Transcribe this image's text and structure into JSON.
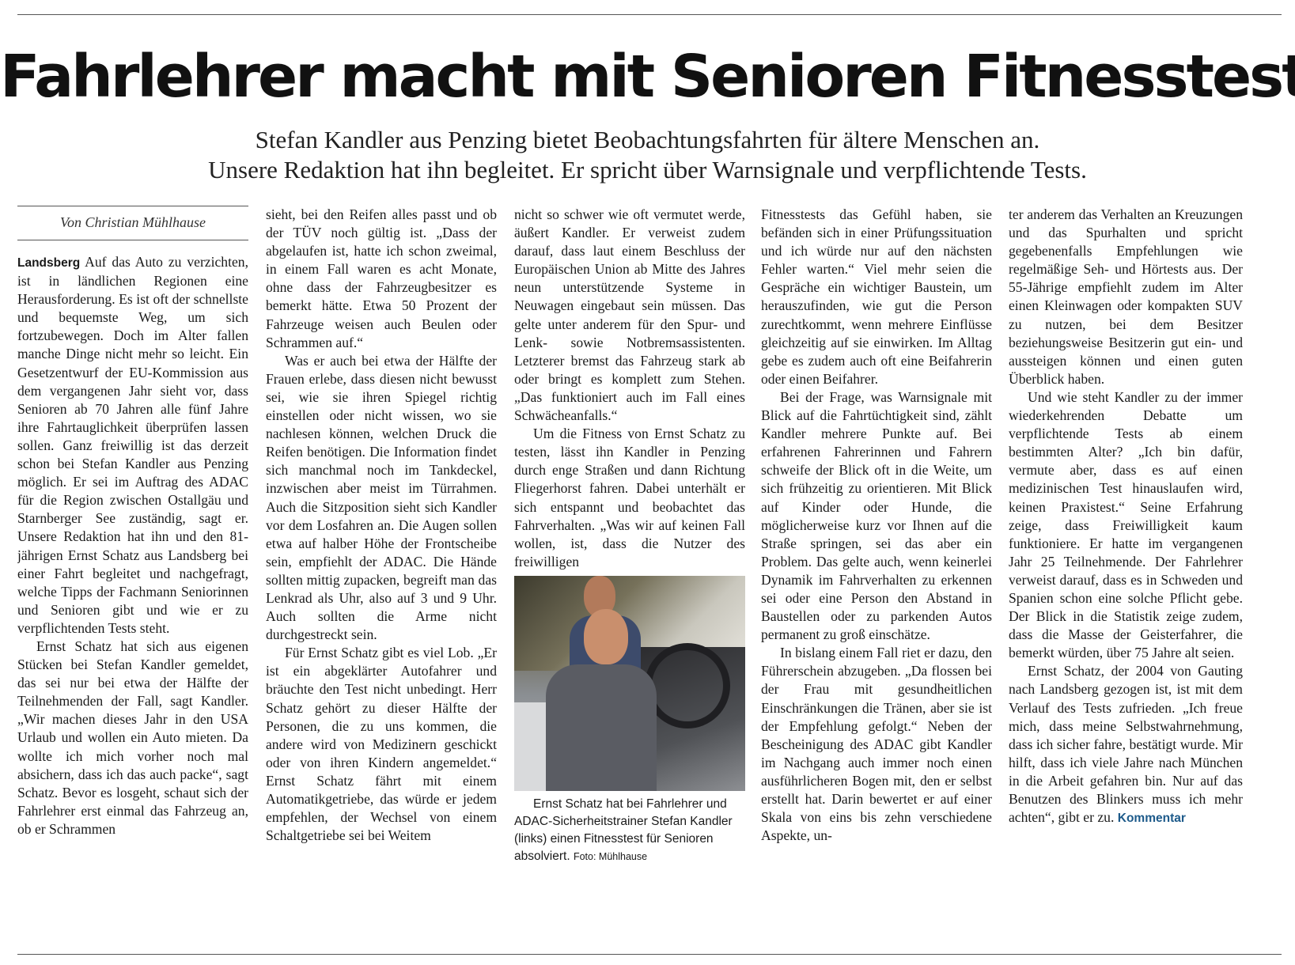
{
  "headline": "Fahrlehrer macht mit Senioren Fitnesstest",
  "subheadline": [
    "Stefan Kandler aus Penzing bietet Beobachtungsfahrten für ältere Menschen an.",
    "Unsere Redaktion hat ihn begleitet. Er spricht über Warnsignale und verpflichtende Tests."
  ],
  "byline": "Von Christian Mühlhause",
  "dateline": "Landsberg",
  "paragraphs": [
    "Auf das Auto zu verzichten, ist in ländlichen Regionen eine Herausforderung. Es ist oft der schnellste und bequemste Weg, um sich fortzubewegen. Doch im Alter fallen manche Dinge nicht mehr so leicht. Ein Gesetzentwurf der EU-Kommission aus dem vergangenen Jahr sieht vor, dass Senioren ab 70 Jahren alle fünf Jahre ihre Fahrtauglichkeit überprüfen lassen sollen. Ganz freiwillig ist das derzeit schon bei Stefan Kandler aus Penzing möglich. Er sei im Auftrag des ADAC für die Region zwischen Ostallgäu und Starnberger See zuständig, sagt er. Unsere Redaktion hat ihn und den 81-jährigen Ernst Schatz aus Landsberg bei einer Fahrt begleitet und nachgefragt, welche Tipps der Fachmann Seniorinnen und Senioren gibt und wie er zu verpflichtenden Tests steht.",
    "Ernst Schatz hat sich aus eigenen Stücken bei Stefan Kandler gemeldet, das sei nur bei etwa der Hälfte der Teilnehmenden der Fall, sagt Kandler. „Wir machen dieses Jahr in den USA Urlaub und wollen ein Auto mieten. Da wollte ich mich vorher noch mal absichern, dass ich das auch packe“, sagt Schatz. Bevor es losgeht, schaut sich der Fahrlehrer erst einmal das Fahrzeug an, ob er Schrammen sieht, bei den Reifen alles passt und ob der TÜV noch gültig ist. „Dass der abgelaufen ist, hatte ich schon zweimal, in einem Fall waren es acht Monate, ohne dass der Fahrzeugbesitzer es bemerkt hätte. Etwa 50 Prozent der Fahrzeuge weisen auch Beulen oder Schrammen auf.“",
    "Was er auch bei etwa der Hälfte der Frauen erlebe, dass diesen nicht bewusst sei, wie sie ihren Spiegel richtig einstellen oder nicht wissen, wo sie nachlesen können, welchen Druck die Reifen benötigen. Die Information findet sich manchmal noch im Tankdeckel, inzwischen aber meist im Türrahmen. Auch die Sitzposition sieht sich Kandler vor dem Losfahren an. Die Augen sollen etwa auf halber Höhe der Frontscheibe sein, empfiehlt der ADAC. Die Hände sollten mittig zupacken, begreift man das Lenkrad als Uhr, also auf 3 und 9 Uhr. Auch sollten die Arme nicht durchgestreckt sein.",
    "Für Ernst Schatz gibt es viel Lob. „Er ist ein abgeklärter Autofahrer und bräuchte den Test nicht unbedingt. Herr Schatz gehört zu dieser Hälfte der Personen, die zu uns kommen, die andere wird von Medizinern geschickt oder von ihren Kindern angemeldet.“ Ernst Schatz fährt mit einem Automatikgetriebe, das würde er jedem empfehlen, der Wechsel von einem Schaltgetriebe sei bei Weitem nicht so schwer wie oft vermutet werde, äußert Kandler. Er verweist zudem darauf, dass laut einem Beschluss der Europäischen Union ab Mitte des Jahres neun unterstützende Systeme in Neuwagen eingebaut sein müssen. Das gelte unter anderem für den Spur- und Lenk- sowie Notbremsassistenten. Letzterer bremst das Fahrzeug stark ab oder bringt es komplett zum Stehen. „Das funktioniert auch im Fall eines Schwächeanfalls.“",
    "Um die Fitness von Ernst Schatz zu testen, lässt ihn Kandler in Penzing durch enge Straßen und dann Richtung Fliegerhorst fahren. Dabei unterhält er sich entspannt und beobachtet das Fahrverhalten. „Was wir auf keinen Fall wollen, ist, dass die Nutzer des freiwilligen",
    "Fitnesstests das Gefühl haben, sie befänden sich in einer Prüfungssituation und ich würde nur auf den nächsten Fehler warten.“ Viel mehr seien die Gespräche ein wichtiger Baustein, um herauszufinden, wie gut die Person zurechtkommt, wenn mehrere Einflüsse gleichzeitig auf sie einwirken. Im Alltag gebe es zudem auch oft eine Beifahrerin oder einen Beifahrer.",
    "Bei der Frage, was Warnsignale mit Blick auf die Fahrtüchtigkeit sind, zählt Kandler mehrere Punkte auf. Bei erfahrenen Fahrerinnen und Fahrern schweife der Blick oft in die Weite, um sich frühzeitig zu orientieren. Mit Blick auf Kinder oder Hunde, die möglicherweise kurz vor Ihnen auf die Straße springen, sei das aber ein Problem. Das gelte auch, wenn keinerlei Dynamik im Fahrverhalten zu erkennen sei oder eine Person den Abstand in Baustellen oder zu parkenden Autos permanent zu groß einschätze.",
    "In bislang einem Fall riet er dazu, den Führerschein abzugeben. „Da flossen bei der Frau mit gesundheitlichen Einschränkungen die Tränen, aber sie ist der Empfehlung gefolgt.“ Neben der Bescheinigung des ADAC gibt Kandler im Nachgang auch immer noch einen ausführlicheren Bogen mit, den er selbst erstellt hat. Darin bewertet er auf einer Skala von eins bis zehn verschiedene Aspekte, unter anderem das Verhalten an Kreuzungen und das Spurhalten und spricht gegebenenfalls Empfehlungen wie regelmäßige Seh- und Hörtests aus. Der 55-Jährige empfiehlt zudem im Alter einen Kleinwagen oder kompakten SUV zu nutzen, bei dem Besitzer beziehungsweise Besitzerin gut ein- und aussteigen können und einen guten Überblick haben.",
    "Und wie steht Kandler zu der immer wiederkehrenden Debatte um verpflichtende Tests ab einem bestimmten Alter? „Ich bin dafür, vermute aber, dass es auf einen medizinischen Test hinauslaufen wird, keinen Praxistest.“ Seine Erfahrung zeige, dass Freiwilligkeit kaum funktioniere. Er hatte im vergangenen Jahr 25 Teilnehmende. Der Fahrlehrer verweist darauf, dass es in Schweden und Spanien schon eine solche Pflicht gebe. Der Blick in die Statistik zeige zudem, dass die Masse der Geisterfahrer, die bemerkt würden, über 75 Jahre alt seien.",
    "Ernst Schatz, der 2004 von Gauting nach Landsberg gezogen ist, ist mit dem Verlauf des Tests zufrieden. „Ich freue mich, dass meine Selbstwahrnehmung, dass ich sicher fahre, bestätigt wurde. Mir hilft, dass ich viele Jahre nach München in die Arbeit gefahren bin. Nur auf das Benutzen des Blinkers muss ich mehr achten“, gibt er zu."
  ],
  "paragraph_fragments": {
    "p2_part1": "Ernst Schatz hat sich aus eigenen Stücken bei Stefan Kandler gemeldet, das sei nur bei etwa der Hälfte der Teilnehmenden der Fall, sagt Kandler. „Wir machen dieses Jahr in den USA Urlaub und wollen ein Auto mieten. Da wollte ich mich vorher noch mal absichern, dass ich das auch packe“, sagt Schatz. Bevor es losgeht, schaut sich der Fahrlehrer erst einmal das Fahrzeug an, ob er Schrammen",
    "p2_part2": "sieht, bei den Reifen alles passt und ob der TÜV noch gültig ist. „Dass der abgelaufen ist, hatte ich schon zweimal, in einem Fall waren es acht Monate, ohne dass der Fahrzeugbesitzer es bemerkt hätte. Etwa 50 Prozent der Fahrzeuge weisen auch Beulen oder Schrammen auf.“",
    "p4_part1": "Für Ernst Schatz gibt es viel Lob. „Er ist ein abgeklärter Autofahrer und bräuchte den Test nicht unbedingt. Herr Schatz gehört zu dieser Hälfte der Personen, die zu uns kommen, die andere wird von Medizinern geschickt oder von ihren Kindern angemeldet.“ Ernst Schatz fährt mit einem Automatikgetriebe, das würde er jedem empfehlen, der Wechsel von einem Schaltgetriebe sei bei Weitem",
    "p4_part2": "nicht so schwer wie oft vermutet werde, äußert Kandler. Er verweist zudem darauf, dass laut einem Beschluss der Europäischen Union ab Mitte des Jahres neun unterstützende Systeme in Neuwagen eingebaut sein müssen. Das gelte unter anderem für den Spur- und Lenk- sowie Notbremsassistenten. Letzterer bremst das Fahrzeug stark ab oder bringt es komplett zum Stehen. „Das funktioniert auch im Fall eines Schwächeanfalls.“",
    "p8_part1": "In bislang einem Fall riet er dazu, den Führerschein abzugeben. „Da flossen bei der Frau mit gesundheitlichen Einschränkungen die Tränen, aber sie ist der Empfehlung gefolgt.“ Neben der Bescheinigung des ADAC gibt Kandler im Nachgang auch immer noch einen ausführlicheren Bogen mit, den er selbst erstellt hat. Darin bewertet er auf einer Skala von eins bis zehn verschiedene Aspekte, un-",
    "p8_part2": "ter anderem das Verhalten an Kreuzungen und das Spurhalten und spricht gegebenenfalls Empfehlungen wie regelmäßige Seh- und Hörtests aus. Der 55-Jährige empfiehlt zudem im Alter einen Kleinwagen oder kompakten SUV zu nutzen, bei dem Besitzer beziehungsweise Besitzerin gut ein- und aussteigen können und einen guten Überblick haben."
  },
  "photo": {
    "caption": "Ernst Schatz hat bei Fahrlehrer und ADAC-Sicherheitstrainer Stefan Kandler (links) einen Fitnesstest für Senioren absolviert.",
    "credit": "Foto: Mühlhause"
  },
  "link_label": "Kommentar"
}
